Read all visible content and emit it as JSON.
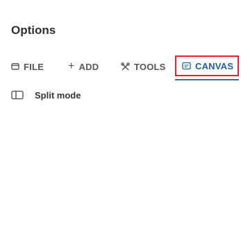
{
  "panel": {
    "title": "Options"
  },
  "tabs": [
    {
      "label": "FILE",
      "icon": "file-icon"
    },
    {
      "label": "ADD",
      "icon": "plus-icon"
    },
    {
      "label": "TOOLS",
      "icon": "tools-icon"
    },
    {
      "label": "CANVAS",
      "icon": "canvas-icon",
      "selected": true
    }
  ],
  "options": {
    "split_mode": {
      "label": "Split mode",
      "icon": "split-mode-icon"
    }
  },
  "colors": {
    "selected_tab_text": "#1e5fa0",
    "selected_tab_underline": "#3d6d97",
    "highlight_border": "#e8202a"
  }
}
